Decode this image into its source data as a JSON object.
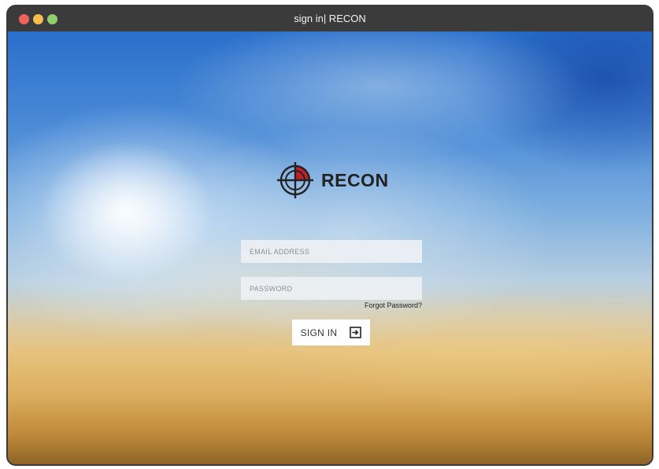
{
  "window": {
    "title": "sign in| RECON"
  },
  "brand": {
    "name": "RECON",
    "logo_icon": "crosshair-icon",
    "accent_color": "#c0202a"
  },
  "form": {
    "email_placeholder": "EMAIL ADDRESS",
    "password_placeholder": "PASSWORD",
    "forgot_label": "Forgot Password?",
    "signin_label": "SIGN IN",
    "signin_icon": "sign-in-arrow-icon"
  }
}
